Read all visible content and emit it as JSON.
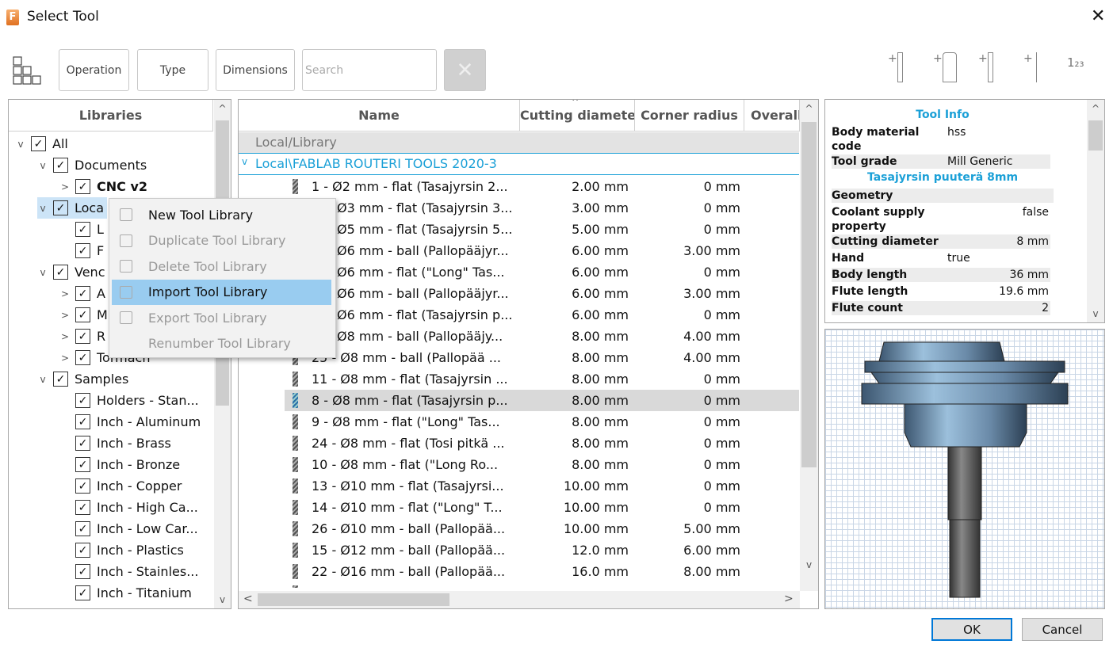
{
  "window": {
    "title": "Select Tool",
    "logo_letter": "F"
  },
  "toolbar": {
    "operation": "Operation",
    "type": "Type",
    "dimensions": "Dimensions",
    "search_placeholder": "Search",
    "clear": "✕",
    "right_icons": [
      "add-mill-tool-icon",
      "add-holder-icon",
      "add-turning-tool-icon",
      "add-probe-icon",
      "renumber-icon"
    ],
    "renumber_glyph": "1₂₃"
  },
  "libraries": {
    "header": "Libraries",
    "items": [
      {
        "label": "All",
        "level": 0,
        "chev": "down"
      },
      {
        "label": "Documents",
        "level": 1,
        "chev": "down"
      },
      {
        "label": "CNC v2",
        "level": 2,
        "chev": "right",
        "bold": true
      },
      {
        "label": "Loca",
        "level": 1,
        "chev": "down",
        "selected": true
      },
      {
        "label": "L",
        "level": 2,
        "chev": ""
      },
      {
        "label": "F",
        "level": 2,
        "chev": ""
      },
      {
        "label": "Venc",
        "level": 1,
        "chev": "down"
      },
      {
        "label": "A",
        "level": 2,
        "chev": "right"
      },
      {
        "label": "M",
        "level": 2,
        "chev": "right"
      },
      {
        "label": "R",
        "level": 2,
        "chev": "right"
      },
      {
        "label": "Tormach",
        "level": 2,
        "chev": "right"
      },
      {
        "label": "Samples",
        "level": 1,
        "chev": "down"
      },
      {
        "label": "Holders - Stan...",
        "level": 2,
        "chev": ""
      },
      {
        "label": "Inch - Aluminum",
        "level": 2,
        "chev": ""
      },
      {
        "label": "Inch - Brass",
        "level": 2,
        "chev": ""
      },
      {
        "label": "Inch - Bronze",
        "level": 2,
        "chev": ""
      },
      {
        "label": "Inch - Copper",
        "level": 2,
        "chev": ""
      },
      {
        "label": "Inch - High Ca...",
        "level": 2,
        "chev": ""
      },
      {
        "label": "Inch - Low Car...",
        "level": 2,
        "chev": ""
      },
      {
        "label": "Inch - Plastics",
        "level": 2,
        "chev": ""
      },
      {
        "label": "Inch - Stainles...",
        "level": 2,
        "chev": ""
      },
      {
        "label": "Inch - Titanium",
        "level": 2,
        "chev": ""
      }
    ]
  },
  "context_menu": {
    "items": [
      {
        "label": "New Tool Library",
        "enabled": true,
        "icon": "new-library-icon"
      },
      {
        "label": "Duplicate Tool Library",
        "enabled": false,
        "icon": "duplicate-icon"
      },
      {
        "label": "Delete Tool Library",
        "enabled": false,
        "icon": "trash-icon"
      },
      {
        "label": "Import Tool Library",
        "enabled": true,
        "icon": "import-icon",
        "highlighted": true
      },
      {
        "label": "Export Tool Library",
        "enabled": false,
        "icon": "export-icon"
      },
      {
        "label": "Renumber Tool Library",
        "enabled": false,
        "icon": ""
      }
    ]
  },
  "tools": {
    "columns": [
      "Name",
      "Cutting diameter",
      "Corner radius",
      "Overall"
    ],
    "group_root": "Local/Library",
    "group": "Local\\FABLAB ROUTERI TOOLS 2020-3",
    "rows": [
      {
        "name": "1 - Ø2 mm - flat (Tasajyrsin 2...",
        "dia": "2.00 mm",
        "rad": "0 mm",
        "hidden": false
      },
      {
        "name": "Ø3 mm - flat (Tasajyrsin 3...",
        "dia": "3.00 mm",
        "rad": "0 mm",
        "hidden": true
      },
      {
        "name": "Ø5 mm - flat (Tasajyrsin 5...",
        "dia": "5.00 mm",
        "rad": "0 mm",
        "hidden": true
      },
      {
        "name": "Ø6 mm - ball (Pallopääjyr...",
        "dia": "6.00 mm",
        "rad": "3.00 mm",
        "hidden": true
      },
      {
        "name": "Ø6 mm - flat (\"Long\" Tas...",
        "dia": "6.00 mm",
        "rad": "0 mm",
        "hidden": true
      },
      {
        "name": "Ø6 mm - ball (Pallopääjyr...",
        "dia": "6.00 mm",
        "rad": "3.00 mm",
        "hidden": true
      },
      {
        "name": "Ø6 mm - flat (Tasajyrsin p...",
        "dia": "6.00 mm",
        "rad": "0 mm",
        "hidden": true
      },
      {
        "name": "Ø8 mm - ball (Pallopääjy...",
        "dia": "8.00 mm",
        "rad": "4.00 mm",
        "hidden": true
      },
      {
        "name": "25 - Ø8 mm - ball (Pallopää ...",
        "dia": "8.00 mm",
        "rad": "4.00 mm",
        "hidden": false
      },
      {
        "name": "11 - Ø8 mm - flat (Tasajyrsin ...",
        "dia": "8.00 mm",
        "rad": "0 mm",
        "hidden": false
      },
      {
        "name": "8 - Ø8 mm - flat (Tasajyrsin p...",
        "dia": "8.00 mm",
        "rad": "0 mm",
        "hidden": false,
        "selected": true
      },
      {
        "name": "9 - Ø8 mm - flat (\"Long\" Tas...",
        "dia": "8.00 mm",
        "rad": "0 mm",
        "hidden": false
      },
      {
        "name": "24 - Ø8 mm - flat (Tosi pitkä ...",
        "dia": "8.00 mm",
        "rad": "0 mm",
        "hidden": false
      },
      {
        "name": "10 - Ø8 mm - flat (\"Long  Ro...",
        "dia": "8.00 mm",
        "rad": "0 mm",
        "hidden": false
      },
      {
        "name": "13 - Ø10 mm - flat (Tasajyrsi...",
        "dia": "10.00 mm",
        "rad": "0 mm",
        "hidden": false
      },
      {
        "name": "14 - Ø10 mm - flat (\"Long\" T...",
        "dia": "10.00 mm",
        "rad": "0 mm",
        "hidden": false
      },
      {
        "name": "26 - Ø10 mm - ball (Pallopää...",
        "dia": "10.00 mm",
        "rad": "5.00 mm",
        "hidden": false
      },
      {
        "name": "15 - Ø12 mm - ball (Pallopää...",
        "dia": "12.0 mm",
        "rad": "6.00 mm",
        "hidden": false
      },
      {
        "name": "22 - Ø16 mm - ball (Pallopää...",
        "dia": "16.0 mm",
        "rad": "8.00 mm",
        "hidden": false
      }
    ]
  },
  "info": {
    "title": "Tool Info",
    "subtitle": "Tasajyrsin puuterä 8mm",
    "geometry": "Geometry",
    "rows_top": [
      [
        "Body material code",
        "hss"
      ],
      [
        "Tool grade",
        "Mill Generic"
      ]
    ],
    "rows_geo": [
      [
        "Coolant supply property",
        "false"
      ],
      [
        "Cutting diameter",
        "8 mm"
      ],
      [
        "Hand",
        "true"
      ],
      [
        "Body length",
        "36 mm"
      ],
      [
        "Flute length",
        "19.6 mm"
      ],
      [
        "Flute count",
        "2"
      ]
    ]
  },
  "dialog": {
    "ok": "OK",
    "cancel": "Cancel"
  },
  "colors": {
    "accent": "#1ba0d7",
    "highlight": "#99ccf0",
    "selected_row": "#d9d9d9"
  }
}
